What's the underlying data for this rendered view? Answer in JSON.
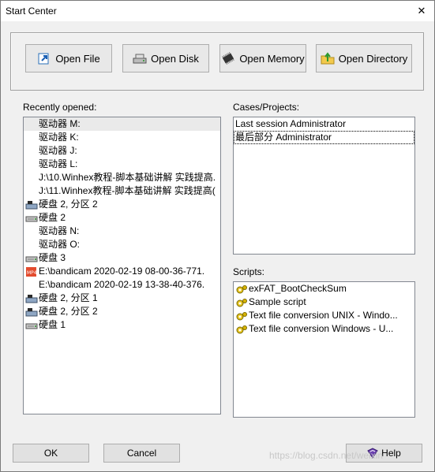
{
  "window": {
    "title": "Start Center",
    "close_glyph": "✕"
  },
  "toolbar": {
    "open_file": {
      "label": "Open File",
      "icon": "arrow-open-icon"
    },
    "open_disk": {
      "label": "Open Disk",
      "icon": "disk-drive-icon"
    },
    "open_memory": {
      "label": "Open Memory",
      "icon": "memory-chip-icon"
    },
    "open_directory": {
      "label": "Open Directory",
      "icon": "folder-up-icon"
    }
  },
  "recent": {
    "label": "Recently opened:",
    "items": [
      {
        "text": "驱动器 M:",
        "icon": "none",
        "selected": true
      },
      {
        "text": "驱动器 K:",
        "icon": "none"
      },
      {
        "text": "驱动器 J:",
        "icon": "none"
      },
      {
        "text": "驱动器 L:",
        "icon": "none"
      },
      {
        "text": "J:\\10.Winhex教程-脚本基础讲解 实践提高.",
        "icon": "none"
      },
      {
        "text": "J:\\11.Winhex教程-脚本基础讲解 实践提高(",
        "icon": "none"
      },
      {
        "text": "硬盘 2, 分区 2",
        "icon": "partition-icon"
      },
      {
        "text": "硬盘 2",
        "icon": "hard-disk-icon"
      },
      {
        "text": "驱动器 N:",
        "icon": "none"
      },
      {
        "text": "驱动器 O:",
        "icon": "none"
      },
      {
        "text": "硬盘 3",
        "icon": "hard-disk-icon"
      },
      {
        "text": "E:\\bandicam 2020-02-19 08-00-36-771.",
        "icon": "mp4-file-icon"
      },
      {
        "text": "E:\\bandicam 2020-02-19 13-38-40-376.",
        "icon": "none"
      },
      {
        "text": "硬盘 2, 分区 1",
        "icon": "partition-icon"
      },
      {
        "text": "硬盘 2, 分区 2",
        "icon": "partition-icon"
      },
      {
        "text": "硬盘 1",
        "icon": "hard-disk-icon"
      }
    ]
  },
  "cases": {
    "label": "Cases/Projects:",
    "items": [
      {
        "text": "Last session Administrator"
      },
      {
        "text": "最后部分 Administrator",
        "focused": true
      }
    ]
  },
  "scripts": {
    "label": "Scripts:",
    "items": [
      {
        "text": "exFAT_BootCheckSum",
        "icon": "script-gear-icon"
      },
      {
        "text": "Sample script",
        "icon": "script-gear-icon"
      },
      {
        "text": "Text file conversion UNIX - Windo...",
        "icon": "script-gear-icon"
      },
      {
        "text": "Text file conversion Windows - U...",
        "icon": "script-gear-icon"
      }
    ]
  },
  "footer": {
    "ok_label": "OK",
    "cancel_label": "Cancel",
    "help_label": "Help",
    "watermark": "https://blog.csdn.net/weixin"
  },
  "colors": {
    "accent": "#0078d7",
    "window_bg": "#f0f0f0",
    "list_border": "#828790"
  }
}
